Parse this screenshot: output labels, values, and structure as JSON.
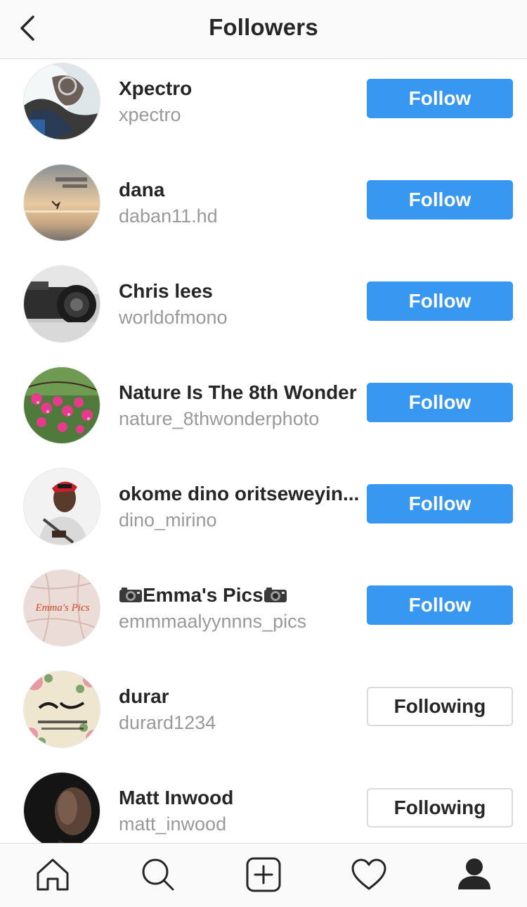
{
  "header": {
    "title": "Followers",
    "back_icon": "chevron-left-icon"
  },
  "followers": [
    {
      "name": "Xpectro",
      "handle": "xpectro",
      "button": "Follow",
      "state": "follow"
    },
    {
      "name": "dana",
      "handle": "daban11.hd",
      "button": "Follow",
      "state": "follow"
    },
    {
      "name": "Chris lees",
      "handle": "worldofmono",
      "button": "Follow",
      "state": "follow"
    },
    {
      "name": "Nature Is The 8th Wonder",
      "handle": "nature_8thwonderphoto",
      "button": "Follow",
      "state": "follow"
    },
    {
      "name": "okome dino oritseweyin...",
      "handle": "dino_mirino",
      "button": "Follow",
      "state": "follow"
    },
    {
      "name": "Emma's Pics",
      "handle": "emmmaalyynnns_pics",
      "button": "Follow",
      "state": "follow"
    },
    {
      "name": "durar",
      "handle": "durard1234",
      "button": "Following",
      "state": "following"
    },
    {
      "name": "Matt Inwood",
      "handle": "matt_inwood",
      "button": "Following",
      "state": "following"
    }
  ],
  "tabbar": {
    "items": [
      "home-icon",
      "search-icon",
      "add-post-icon",
      "heart-icon",
      "profile-icon"
    ],
    "active": "profile-icon"
  },
  "colors": {
    "accent": "#3897f0",
    "text": "#262626",
    "secondary_text": "#999999",
    "border": "#dbdbdb"
  }
}
